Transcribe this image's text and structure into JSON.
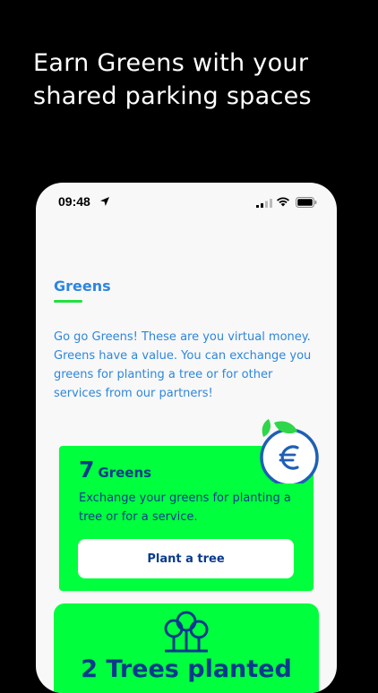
{
  "headline": "Earn Greens with your shared parking spaces",
  "status_bar": {
    "time": "09:48",
    "icons": [
      "location-arrow-icon",
      "signal-icon",
      "wifi-icon",
      "battery-icon"
    ]
  },
  "section": {
    "title": "Greens",
    "intro": "Go go Greens! These are you virtual money. Greens have a value. You can exchange you greens for planting a tree or for other services from our partners!"
  },
  "greens_card": {
    "count": "7",
    "unit": "Greens",
    "description": "Exchange your greens for planting a tree or for a service.",
    "button_label": "Plant a tree",
    "badge_icon": "euro-leaf-icon"
  },
  "trees_card": {
    "icon": "trees-icon",
    "label": "2 Trees planted"
  },
  "colors": {
    "background": "#000000",
    "phone_bg": "#f8f8f8",
    "accent_blue": "#2e86de",
    "dark_blue": "#0a3a8c",
    "green": "#00ff3c"
  }
}
